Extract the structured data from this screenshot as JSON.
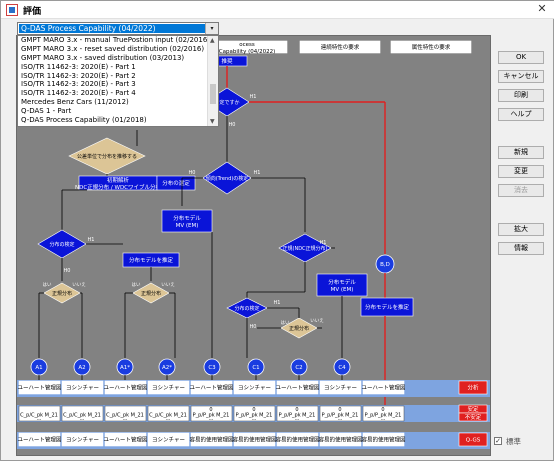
{
  "window": {
    "title": "評価",
    "close_glyph": "✕"
  },
  "dropdown": {
    "selected": "Q-DAS Process Capability (04/2022)",
    "arrow": "▾",
    "options": [
      "GMPT MARO 3.x - manual TruePostion input (02/2016)",
      "GMPT MARO 3.x - reset saved distribution (02/2016)",
      "GMPT MARO 3.x - saved distribution (03/2013)",
      "ISO/TR 11462-3: 2020(E) - Part 1",
      "ISO/TR 11462-3: 2020(E) - Part 2",
      "ISO/TR 11462-3: 2020(E) - Part 3",
      "ISO/TR 11462-3: 2020(E) - Part 4",
      "Mercedes Benz Cars (11/2012)",
      "Q-DAS 1 - Part",
      "Q-DAS Process Capability (01/2018)"
    ]
  },
  "buttons": {
    "ok": "OK",
    "cancel": "キャンセル",
    "print": "印刷",
    "help": "ヘルプ",
    "new": "新規",
    "change": "変更",
    "delete": "消去",
    "zoom": "拡大",
    "info": "情報"
  },
  "standard_checkbox": {
    "label": "標準",
    "checked": true,
    "glyph": "✓"
  },
  "flowchart": {
    "header_boxes": [
      "ocess Capability (04/2022)",
      "連続特性の要求",
      "属性特性の要求"
    ],
    "top_box": "推奨",
    "diamond_top": "一定ですか",
    "diamond_left": "公差単位で分布を推移する",
    "box_left_a": "初期解析 NDC正規分布 / WDCワイブル分布",
    "box_left_b": "分布の選定",
    "diamond_trend": "傾向(Trend)の検定",
    "box_mv1": "分布モデル MV (EM)",
    "diamond_ndc": "正規(NDC正規分布)",
    "box_mv2": "分布モデル MV (EM)",
    "diamond_left2": "分布の検定",
    "box_left_c": "分布モデルを推定",
    "diamond_left3a": "正規分布",
    "diamond_left3b": "正規分布",
    "diamond_c": "分布の検定",
    "diamond_c2": "正規分布",
    "box_red_right": "分布モデルを推定",
    "circle_bd": "B,D",
    "labels_hl": {
      "h1": "H1",
      "h0": "H0",
      "yes": "はい",
      "no": "いいえ"
    },
    "circles": [
      "A1",
      "A2",
      "A1*",
      "A2*",
      "C3",
      "C1",
      "C2",
      "C4"
    ],
    "row1": [
      "ユーハート管理図",
      "ヨシンチャー",
      "ユーハート管理図",
      "ヨシンチャー",
      "ユーハート管理図",
      "ヨシンチャー",
      "ユーハート管理図",
      "ヨシンチャー",
      "ユーハート管理図"
    ],
    "row2": [
      "C_p/C_pk M_21",
      "C_p/C_pk M_21",
      "C_p/C_pk M_21",
      "C_p/C_pk M_21",
      "P_p/P_pk M_21",
      "P_p/P_pk M_21",
      "P_p/P_pk M_21",
      "P_p/P_pk M_21",
      "P_p/P_pk M_21"
    ],
    "row2_top": [
      "0",
      "0",
      "0",
      "0",
      "0"
    ],
    "row2_bot": [
      "---",
      "---",
      "---",
      "---",
      "---",
      "---",
      "---",
      "---",
      "---"
    ],
    "row3": [
      "ユーハート管理図",
      "ヨシンチャー",
      "ユーハート管理図",
      "ヨシンチャー",
      "容易的使用管理図",
      "容易的使用管理図",
      "容易的使用管理図",
      "容易的使用管理図",
      "容易的使用管理図"
    ],
    "side_labels": {
      "analysis": "分析",
      "stable": "安定",
      "unstable": "不安定",
      "qgs": "Q-GS"
    }
  },
  "colors": {
    "flow_blue": "#0a14d8",
    "flow_tan": "#dcc596",
    "flow_red": "#e02020",
    "canvas_grey": "#828282",
    "row_band": "#7ea4e0"
  }
}
